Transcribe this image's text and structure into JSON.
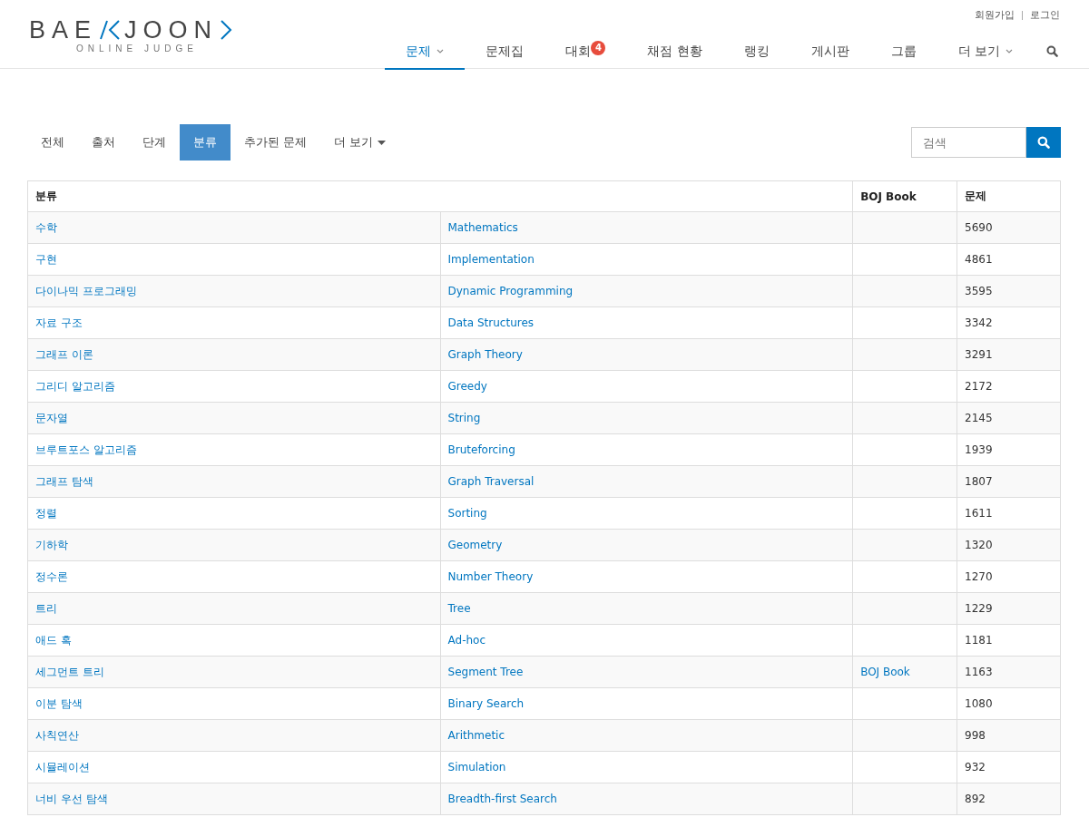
{
  "logo": {
    "left": "BAE",
    "right": "JOON",
    "subtitle": "ONLINE JUDGE"
  },
  "top_links": [
    "회원가입",
    "로그인"
  ],
  "nav": [
    {
      "label": "문제",
      "selected": true,
      "caret": true
    },
    {
      "label": "문제집",
      "selected": false
    },
    {
      "label": "대회",
      "selected": false,
      "badge": "4"
    },
    {
      "label": "채점 현황",
      "selected": false
    },
    {
      "label": "랭킹",
      "selected": false
    },
    {
      "label": "게시판",
      "selected": false
    },
    {
      "label": "그룹",
      "selected": false
    },
    {
      "label": "더 보기",
      "selected": false,
      "caret": true
    }
  ],
  "tabs": [
    {
      "label": "전체",
      "selected": false
    },
    {
      "label": "출처",
      "selected": false
    },
    {
      "label": "단계",
      "selected": false
    },
    {
      "label": "분류",
      "selected": true
    },
    {
      "label": "추가된 문제",
      "selected": false
    },
    {
      "label": "더 보기",
      "selected": false,
      "caret": true
    }
  ],
  "search": {
    "placeholder": "검색"
  },
  "table": {
    "columns": [
      "분류",
      "BOJ Book",
      "문제"
    ],
    "rows": [
      {
        "korean": "수학",
        "english": "Mathematics",
        "count": "5690"
      },
      {
        "korean": "구현",
        "english": "Implementation",
        "count": "4861"
      },
      {
        "korean": "다이나믹 프로그래밍",
        "english": "Dynamic Programming",
        "count": "3595"
      },
      {
        "korean": "자료 구조",
        "english": "Data Structures",
        "count": "3342"
      },
      {
        "korean": "그래프 이론",
        "english": "Graph Theory",
        "count": "3291"
      },
      {
        "korean": "그리디 알고리즘",
        "english": "Greedy",
        "count": "2172"
      },
      {
        "korean": "문자열",
        "english": "String",
        "count": "2145"
      },
      {
        "korean": "브루트포스 알고리즘",
        "english": "Bruteforcing",
        "count": "1939"
      },
      {
        "korean": "그래프 탐색",
        "english": "Graph Traversal",
        "count": "1807"
      },
      {
        "korean": "정렬",
        "english": "Sorting",
        "count": "1611"
      },
      {
        "korean": "기하학",
        "english": "Geometry",
        "count": "1320"
      },
      {
        "korean": "정수론",
        "english": "Number Theory",
        "count": "1270"
      },
      {
        "korean": "트리",
        "english": "Tree",
        "count": "1229"
      },
      {
        "korean": "애드 혹",
        "english": "Ad-hoc",
        "count": "1181"
      },
      {
        "korean": "세그먼트 트리",
        "english": "Segment Tree",
        "book": "BOJ Book",
        "count": "1163"
      },
      {
        "korean": "이분 탐색",
        "english": "Binary Search",
        "count": "1080"
      },
      {
        "korean": "사칙연산",
        "english": "Arithmetic",
        "count": "998"
      },
      {
        "korean": "시뮬레이션",
        "english": "Simulation",
        "count": "932"
      },
      {
        "korean": "너비 우선 탐색",
        "english": "Breadth-first Search",
        "count": "892"
      }
    ]
  }
}
